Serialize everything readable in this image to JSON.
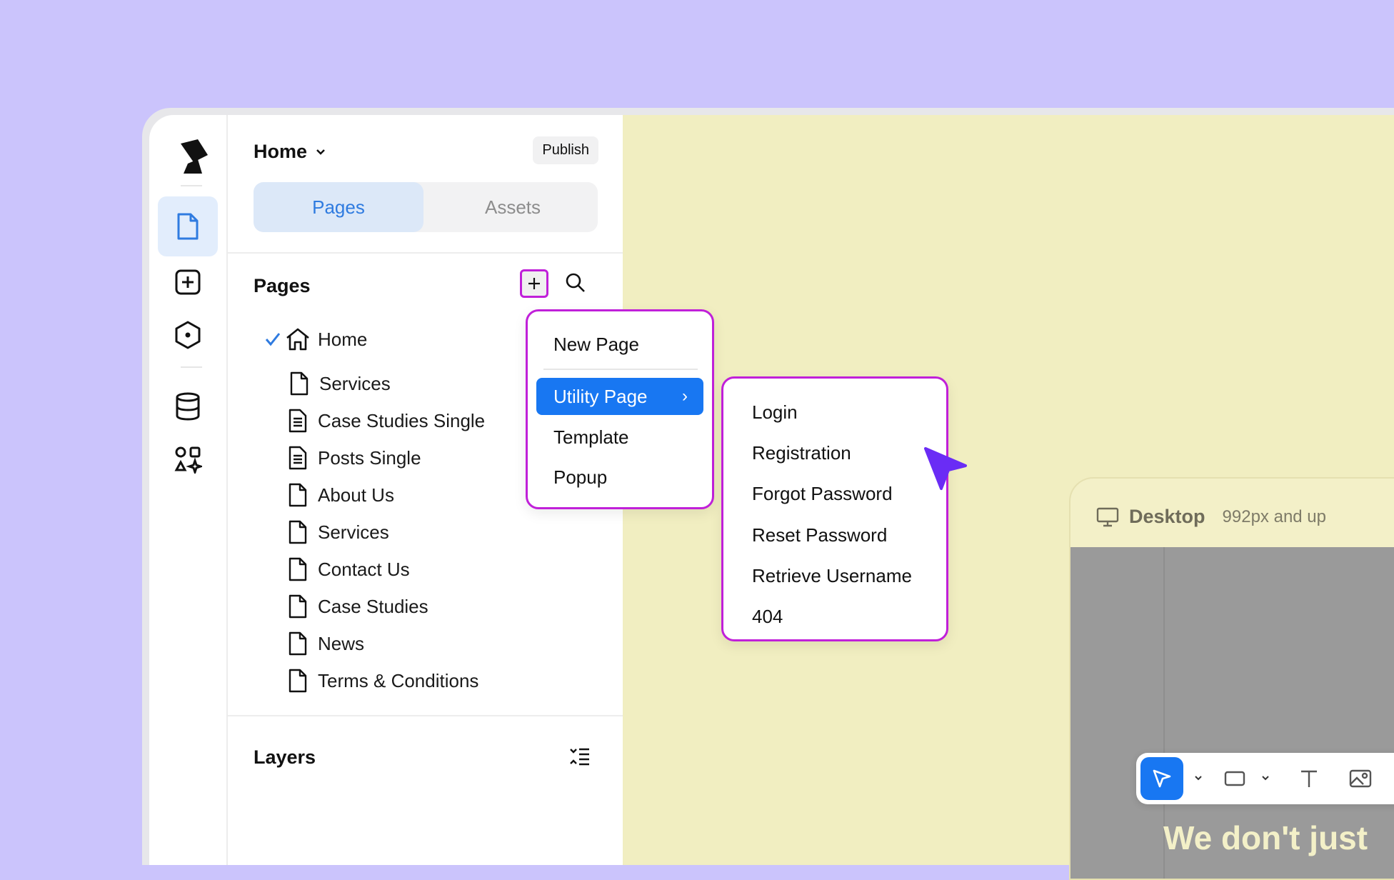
{
  "header": {
    "page_name": "Home",
    "publish_label": "Publish"
  },
  "tabs": {
    "pages": "Pages",
    "assets": "Assets"
  },
  "pages_section": {
    "title": "Pages",
    "items": [
      {
        "label": "Home",
        "icon": "home-icon",
        "selected": true
      },
      {
        "label": "Services",
        "icon": "file-icon"
      },
      {
        "label": "Case Studies Single",
        "icon": "file-text-icon"
      },
      {
        "label": "Posts Single",
        "icon": "file-text-icon"
      },
      {
        "label": "About Us",
        "icon": "file-icon"
      },
      {
        "label": "Services",
        "icon": "file-icon"
      },
      {
        "label": "Contact Us",
        "icon": "file-icon"
      },
      {
        "label": "Case Studies",
        "icon": "file-icon"
      },
      {
        "label": "News",
        "icon": "file-icon"
      },
      {
        "label": "Terms & Conditions",
        "icon": "file-icon"
      }
    ]
  },
  "layers_section": {
    "title": "Layers"
  },
  "add_menu": {
    "items": [
      "New Page",
      "Utility Page",
      "Template",
      "Popup"
    ],
    "highlighted": "Utility Page",
    "arrow": "›"
  },
  "utility_submenu": {
    "items": [
      "Login",
      "Registration",
      "Forgot Password",
      "Reset Password",
      "Retrieve Username",
      "404"
    ]
  },
  "canvas": {
    "device_name": "Desktop",
    "device_range": "992px and up",
    "hero_text": "We don't just"
  },
  "colors": {
    "background": "#cbc4fc",
    "accent": "#1877f2",
    "highlight_border": "#c020d9",
    "canvas": "#f1eec1",
    "cursor": "#6a2cf5"
  }
}
